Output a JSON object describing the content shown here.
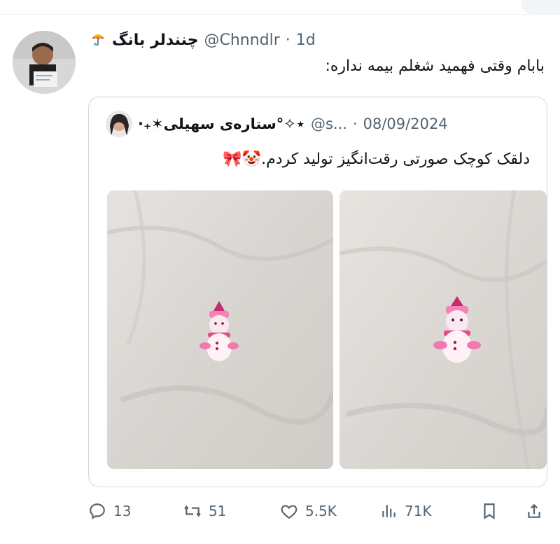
{
  "tweet": {
    "display_name": "چنندلر بانگ",
    "handle": "@Chnndlr",
    "separator": "·",
    "time": "1d",
    "text": "بابام وقتی فهمید شغلم بیمه نداره:",
    "umbrella_icon": "umbrella-icon"
  },
  "quote": {
    "display_name": "⋆✧°ستاره‌ی سهیلی✶₊·",
    "handle": "@s...",
    "separator": "·",
    "date": "08/09/2024",
    "text": "دلقک کوچک صورتی رقت‌انگیز تولید کردم.🤡🎀",
    "images": [
      "snowman-figurine-photo-left",
      "snowman-figurine-photo-right"
    ]
  },
  "actions": {
    "replies": "13",
    "retweets": "51",
    "likes": "5.5K",
    "views": "71K"
  },
  "colors": {
    "text": "#0f1419",
    "secondary": "#536471",
    "border": "#cfd9de"
  }
}
